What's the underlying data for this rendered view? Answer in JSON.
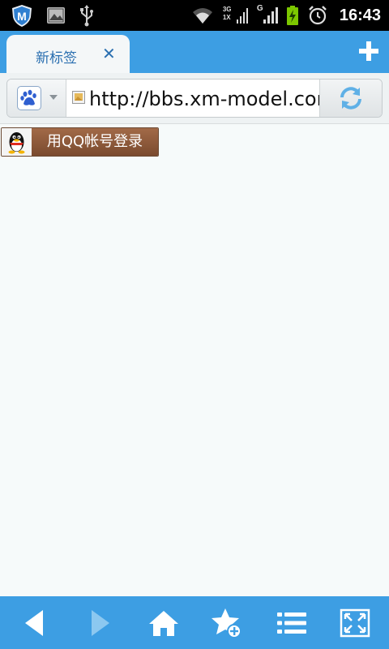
{
  "status_bar": {
    "time": "16:43",
    "network_3g": "3G",
    "network_1x": "1X",
    "network_g": "G",
    "icons": [
      "shield-m-icon",
      "image-icon",
      "usb-icon",
      "wifi-icon",
      "signal-3g-icon",
      "signal-g-icon",
      "battery-charging-icon",
      "alarm-icon"
    ]
  },
  "tabs": [
    {
      "title": "新标签",
      "active": true
    }
  ],
  "address_bar": {
    "url": "http://bbs.xm-model.com",
    "search_engine_icon": "baidu-paw-icon"
  },
  "page": {
    "qq_login_label": "用QQ帐号登录"
  },
  "toolbar": {
    "buttons": [
      "back",
      "forward",
      "home",
      "add-bookmark",
      "menu",
      "fullscreen"
    ]
  },
  "colors": {
    "accent": "#3d9ee3",
    "tab_text": "#2a6fb0",
    "qq_button": "#8b5a3c",
    "page_bg": "#f6fafa"
  }
}
